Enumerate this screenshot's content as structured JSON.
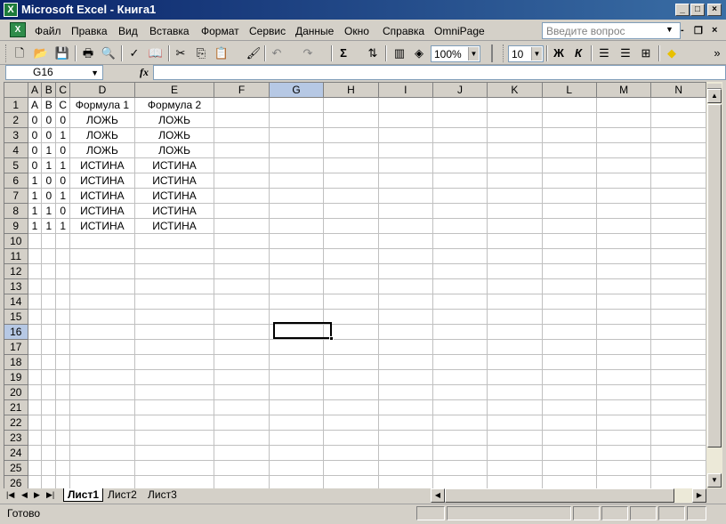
{
  "window": {
    "title": "Microsoft Excel - Книга1",
    "app_icon": "excel-icon",
    "controls": [
      "_",
      "□",
      "×"
    ]
  },
  "menu": {
    "items": [
      "Файл",
      "Правка",
      "Вид",
      "Вставка",
      "Формат",
      "Сервис",
      "Данные",
      "Окно",
      "Справка",
      "OmniPage"
    ],
    "ask_placeholder": "Введите вопрос",
    "mdi_controls": [
      "-",
      "❐",
      "×"
    ]
  },
  "toolbar": {
    "zoom": "100%",
    "font_size": "10",
    "bold_label": "Ж",
    "italic_label": "К",
    "sigma": "Σ"
  },
  "formula_bar": {
    "name_box": "G16",
    "fx_label": "fx",
    "formula": ""
  },
  "sheet": {
    "columns": [
      "A",
      "B",
      "C",
      "D",
      "E",
      "F",
      "G",
      "H",
      "I",
      "J",
      "K",
      "L",
      "M",
      "N"
    ],
    "selected_column": "G",
    "selected_row": "16",
    "rows": [
      {
        "n": "1",
        "cells": [
          "A",
          "B",
          "C",
          "Формула 1",
          "Формула 2",
          "",
          "",
          "",
          "",
          "",
          "",
          "",
          "",
          ""
        ]
      },
      {
        "n": "2",
        "cells": [
          "0",
          "0",
          "0",
          "ЛОЖЬ",
          "ЛОЖЬ",
          "",
          "",
          "",
          "",
          "",
          "",
          "",
          "",
          ""
        ]
      },
      {
        "n": "3",
        "cells": [
          "0",
          "0",
          "1",
          "ЛОЖЬ",
          "ЛОЖЬ",
          "",
          "",
          "",
          "",
          "",
          "",
          "",
          "",
          ""
        ]
      },
      {
        "n": "4",
        "cells": [
          "0",
          "1",
          "0",
          "ЛОЖЬ",
          "ЛОЖЬ",
          "",
          "",
          "",
          "",
          "",
          "",
          "",
          "",
          ""
        ]
      },
      {
        "n": "5",
        "cells": [
          "0",
          "1",
          "1",
          "ИСТИНА",
          "ИСТИНА",
          "",
          "",
          "",
          "",
          "",
          "",
          "",
          "",
          ""
        ]
      },
      {
        "n": "6",
        "cells": [
          "1",
          "0",
          "0",
          "ИСТИНА",
          "ИСТИНА",
          "",
          "",
          "",
          "",
          "",
          "",
          "",
          "",
          ""
        ]
      },
      {
        "n": "7",
        "cells": [
          "1",
          "0",
          "1",
          "ИСТИНА",
          "ИСТИНА",
          "",
          "",
          "",
          "",
          "",
          "",
          "",
          "",
          ""
        ]
      },
      {
        "n": "8",
        "cells": [
          "1",
          "1",
          "0",
          "ИСТИНА",
          "ИСТИНА",
          "",
          "",
          "",
          "",
          "",
          "",
          "",
          "",
          ""
        ]
      },
      {
        "n": "9",
        "cells": [
          "1",
          "1",
          "1",
          "ИСТИНА",
          "ИСТИНА",
          "",
          "",
          "",
          "",
          "",
          "",
          "",
          "",
          ""
        ]
      },
      {
        "n": "10",
        "cells": []
      },
      {
        "n": "11",
        "cells": []
      },
      {
        "n": "12",
        "cells": []
      },
      {
        "n": "13",
        "cells": []
      },
      {
        "n": "14",
        "cells": []
      },
      {
        "n": "15",
        "cells": []
      },
      {
        "n": "16",
        "cells": []
      },
      {
        "n": "17",
        "cells": []
      },
      {
        "n": "18",
        "cells": []
      },
      {
        "n": "19",
        "cells": []
      },
      {
        "n": "20",
        "cells": []
      },
      {
        "n": "21",
        "cells": []
      },
      {
        "n": "22",
        "cells": []
      },
      {
        "n": "23",
        "cells": []
      },
      {
        "n": "24",
        "cells": []
      },
      {
        "n": "25",
        "cells": []
      },
      {
        "n": "26",
        "cells": []
      }
    ]
  },
  "tabs": {
    "sheets": [
      "Лист1",
      "Лист2",
      "Лист3"
    ],
    "active": "Лист1"
  },
  "status": {
    "text": "Готово"
  },
  "colors": {
    "title_gradient_start": "#0a246a",
    "title_gradient_end": "#3a6ea5",
    "chrome": "#d4d0c8",
    "selected_header": "#ffcf80"
  }
}
